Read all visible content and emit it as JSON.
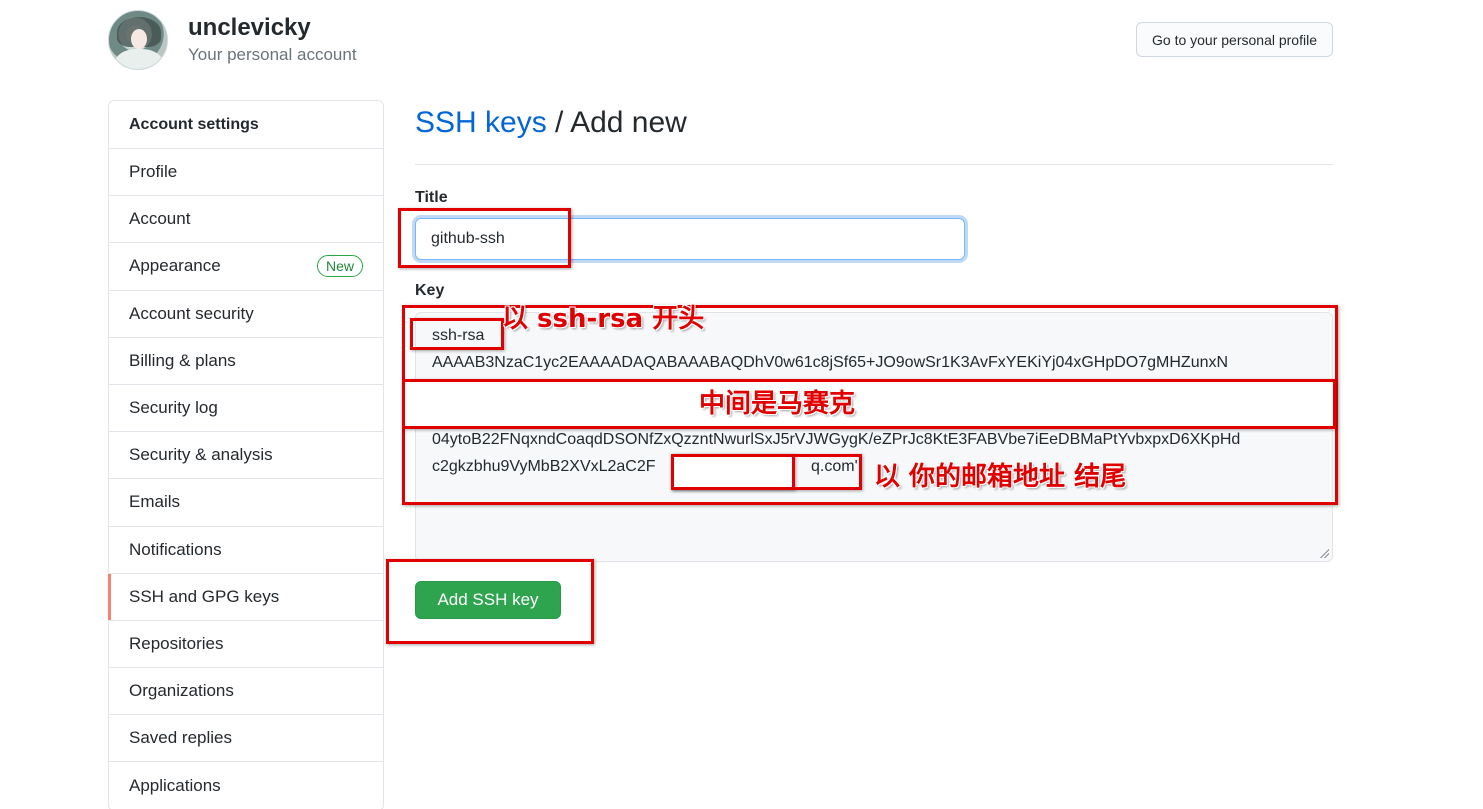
{
  "header": {
    "username": "unclevicky",
    "subtitle": "Your personal account",
    "profile_button": "Go to your personal profile"
  },
  "sidebar": {
    "heading": "Account settings",
    "items": [
      {
        "label": "Profile"
      },
      {
        "label": "Account"
      },
      {
        "label": "Appearance",
        "badge": "New"
      },
      {
        "label": "Account security"
      },
      {
        "label": "Billing & plans"
      },
      {
        "label": "Security log"
      },
      {
        "label": "Security & analysis"
      },
      {
        "label": "Emails"
      },
      {
        "label": "Notifications"
      },
      {
        "label": "SSH and GPG keys",
        "selected": true
      },
      {
        "label": "Repositories"
      },
      {
        "label": "Organizations"
      },
      {
        "label": "Saved replies"
      },
      {
        "label": "Applications"
      }
    ]
  },
  "main": {
    "breadcrumb_link": "SSH keys",
    "breadcrumb_sep": " / ",
    "breadcrumb_current": "Add new",
    "title_label": "Title",
    "title_value": "github-ssh",
    "key_label": "Key",
    "key_lines": [
      "ssh-rsa",
      "AAAAB3NzaC1yc2EAAAADAQABAAABAQDhV0w61c8jSf65+JO9owSr1K3AvFxYEKiYj04xGHpDO7gMHZunxN",
      "04ytoB22FNqxndCoaqdDSONfZxQzzntNwurlSxJ5rVJWGygK/eZPrJc8KtE3FABVbe7iEeDBMaPtYvbxpxD6XKpHd",
      "c2gkzbhu9VyMbB2XVxL2aC2F",
      "q.com'"
    ],
    "submit_button": "Add SSH key"
  },
  "annotations": {
    "start_note": "以 ssh-rsa 开头",
    "middle_note": "中间是马赛克",
    "end_note": "以 你的邮箱地址 结尾",
    "color": "#e00000"
  },
  "colors": {
    "link": "#0366d6",
    "primary_button": "#2ea44f",
    "selected_marker": "#f9826c",
    "badge_green": "#22863a"
  }
}
